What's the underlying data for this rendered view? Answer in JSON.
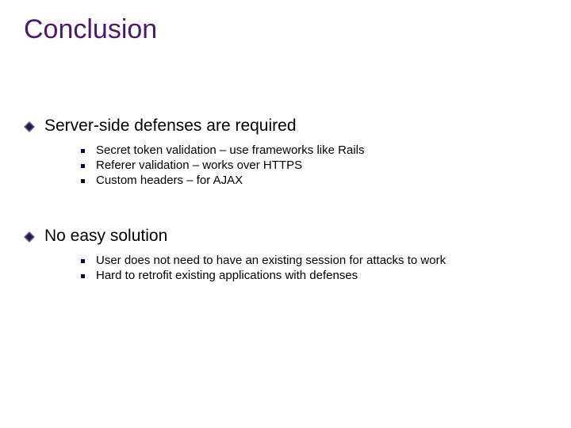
{
  "title": "Conclusion",
  "items": [
    {
      "text": "Server-side defenses are required",
      "subitems": [
        "Secret token validation – use frameworks like Rails",
        "Referer validation – works over HTTPS",
        "Custom headers – for AJAX"
      ]
    },
    {
      "text": "No easy solution",
      "subitems": [
        "User does not need to have an existing session for attacks to work",
        "Hard to retrofit existing applications with defenses"
      ]
    }
  ]
}
